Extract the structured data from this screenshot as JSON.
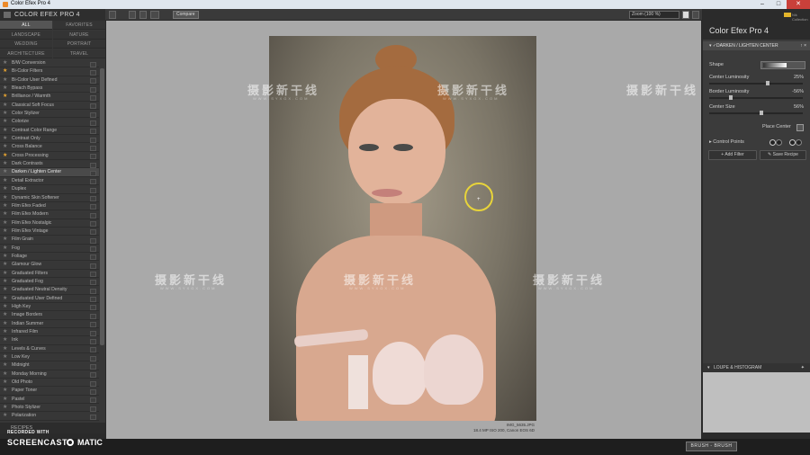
{
  "window": {
    "title": "Color Efex Pro 4"
  },
  "left_panel": {
    "title": "COLOR EFEX PRO 4",
    "categories": [
      "ALL",
      "FAVORITES",
      "LANDSCAPE",
      "NATURE",
      "WEDDING",
      "PORTRAIT",
      "ARCHITECTURE",
      "TRAVEL"
    ],
    "active_category": "ALL",
    "filters": [
      {
        "name": "B/W Conversion",
        "fav": false
      },
      {
        "name": "Bi-Color Filters",
        "fav": true
      },
      {
        "name": "Bi-Color User Defined",
        "fav": false
      },
      {
        "name": "Bleach Bypass",
        "fav": false
      },
      {
        "name": "Brilliance / Warmth",
        "fav": true
      },
      {
        "name": "Classical Soft Focus",
        "fav": false
      },
      {
        "name": "Color Stylizer",
        "fav": false
      },
      {
        "name": "Colorize",
        "fav": false
      },
      {
        "name": "Contrast Color Range",
        "fav": false
      },
      {
        "name": "Contrast Only",
        "fav": false
      },
      {
        "name": "Cross Balance",
        "fav": false
      },
      {
        "name": "Cross Processing",
        "fav": true
      },
      {
        "name": "Dark Contrasts",
        "fav": false
      },
      {
        "name": "Darken / Lighten Center",
        "fav": false,
        "active": true
      },
      {
        "name": "Detail Extractor",
        "fav": false
      },
      {
        "name": "Duplex",
        "fav": false
      },
      {
        "name": "Dynamic Skin Softener",
        "fav": false
      },
      {
        "name": "Film Efex Faded",
        "fav": false
      },
      {
        "name": "Film Efex Modern",
        "fav": false
      },
      {
        "name": "Film Efex Nostalgic",
        "fav": false
      },
      {
        "name": "Film Efex Vintage",
        "fav": false
      },
      {
        "name": "Film Grain",
        "fav": false
      },
      {
        "name": "Fog",
        "fav": false
      },
      {
        "name": "Foliage",
        "fav": false
      },
      {
        "name": "Glamour Glow",
        "fav": false
      },
      {
        "name": "Graduated Filters",
        "fav": false
      },
      {
        "name": "Graduated Fog",
        "fav": false
      },
      {
        "name": "Graduated Neutral Density",
        "fav": false
      },
      {
        "name": "Graduated User Defined",
        "fav": false
      },
      {
        "name": "High Key",
        "fav": false
      },
      {
        "name": "Image Borders",
        "fav": false
      },
      {
        "name": "Indian Summer",
        "fav": false
      },
      {
        "name": "Infrared Film",
        "fav": false
      },
      {
        "name": "Ink",
        "fav": false
      },
      {
        "name": "Levels & Curves",
        "fav": false
      },
      {
        "name": "Low Key",
        "fav": false
      },
      {
        "name": "Midnight",
        "fav": false
      },
      {
        "name": "Monday Morning",
        "fav": false
      },
      {
        "name": "Old Photo",
        "fav": false
      },
      {
        "name": "Paper Toner",
        "fav": false
      },
      {
        "name": "Pastel",
        "fav": false
      },
      {
        "name": "Photo Stylizer",
        "fav": false
      },
      {
        "name": "Polarization",
        "fav": false
      }
    ],
    "recipes_label": "RECIPES"
  },
  "toolbar": {
    "compare_label": "Compare",
    "zoom_label": "Zoom (100 %)"
  },
  "image": {
    "filename": "IMG_5635.JPG",
    "info": "18.4 MP ISO 200, Canon EOS 6D"
  },
  "watermark": {
    "text": "摄影新干线",
    "subtext": "WWW.SYXGX.COM"
  },
  "right_panel": {
    "brand": "Nik Collection",
    "title": "Color Efex Pro",
    "version": "4",
    "filter_header": "DARKEN / LIGHTEN CENTER",
    "shape_label": "Shape",
    "center_luminosity_label": "Center Luminosity",
    "center_luminosity_value": "25%",
    "center_luminosity_level": 0.625,
    "border_luminosity_label": "Border Luminosity",
    "border_luminosity_value": "-56%",
    "border_luminosity_level": 0.22,
    "center_size_label": "Center Size",
    "center_size_value": "56%",
    "center_size_level": 0.56,
    "place_center_label": "Place Center",
    "control_points_label": "Control Points",
    "add_filter_label": "Add Filter",
    "save_recipe_label": "Save Recipe",
    "loupe_label": "LOUPE & HISTOGRAM"
  },
  "bottom_bar": {
    "brush_label": "BRUSH - BRUSH"
  },
  "screencast": {
    "recorded_with": "RECORDED WITH",
    "brand_left": "SCREENCAST",
    "brand_right": "MATIC"
  },
  "colors": {
    "accent_orange": "#ec8a2a",
    "favorite_star": "#e9a531",
    "cursor_ring": "#e8d43a",
    "close_button": "#c9403a"
  }
}
